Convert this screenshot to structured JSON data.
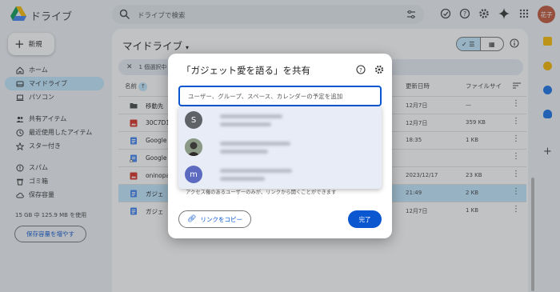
{
  "header": {
    "app_title": "ドライブ",
    "search_placeholder": "ドライブで検索",
    "avatar_text": "花子"
  },
  "sidebar": {
    "new_label": "新規",
    "items": [
      {
        "label": "ホーム",
        "icon": "home-icon"
      },
      {
        "label": "マイドライブ",
        "icon": "my-drive-icon",
        "active": true
      },
      {
        "label": "パソコン",
        "icon": "computer-icon"
      },
      {
        "label": "共有アイテム",
        "icon": "shared-icon"
      },
      {
        "label": "最近使用したアイテム",
        "icon": "clock-icon"
      },
      {
        "label": "スター付き",
        "icon": "star-icon"
      },
      {
        "label": "スパム",
        "icon": "spam-icon"
      },
      {
        "label": "ゴミ箱",
        "icon": "trash-icon"
      },
      {
        "label": "保存容量",
        "icon": "cloud-icon"
      }
    ],
    "storage_text": "15 GB 中 125.9 MB を使用",
    "storage_button": "保存容量を増やす"
  },
  "main": {
    "title": "マイドライブ",
    "selection_text": "1 個選択中",
    "columns": {
      "name": "名前",
      "modified": "更新日時",
      "size": "ファイルサイ"
    },
    "rows": [
      {
        "name": "移動先",
        "date": "12月7日",
        "size": "—",
        "icon": "folder-icon",
        "color": "#444746"
      },
      {
        "name": "30C7D1",
        "date": "12月7日",
        "size": "359 KB",
        "icon": "image-icon",
        "color": "#d93025"
      },
      {
        "name": "Google",
        "date": "18:35",
        "size": "1 KB",
        "icon": "docs-icon",
        "color": "#4285f4"
      },
      {
        "name": "Google",
        "date": "",
        "size": "",
        "icon": "docs-shortcut-icon",
        "color": "#4285f4"
      },
      {
        "name": "oninopa",
        "date": "2023/12/17",
        "size": "23 KB",
        "icon": "image-icon",
        "color": "#d93025"
      },
      {
        "name": "ガジェ",
        "date": "21:49",
        "size": "2 KB",
        "icon": "docs-icon",
        "color": "#4285f4",
        "selected": true
      },
      {
        "name": "ガジェ",
        "date": "12月7日",
        "size": "1 KB",
        "icon": "docs-icon",
        "color": "#4285f4"
      }
    ]
  },
  "dialog": {
    "title": "「ガジェット愛を語る」を共有",
    "input_placeholder": "ユーザー、グループ、スペース、カレンダーの予定を追加",
    "suggestions": [
      {
        "avatar": "S",
        "avatar_color": "#5f6368"
      },
      {
        "avatar": "",
        "avatar_color": "#6d7a6a"
      },
      {
        "avatar": "m",
        "avatar_color": "#5c6bc0"
      }
    ],
    "note": "アクセス権のあるユーザーのみが、リンクから開くことができます",
    "copy_link_label": "リンクをコピー",
    "done_label": "完了"
  },
  "colors": {
    "accent": "#0b57d0",
    "active_bg": "#c2e7ff"
  }
}
